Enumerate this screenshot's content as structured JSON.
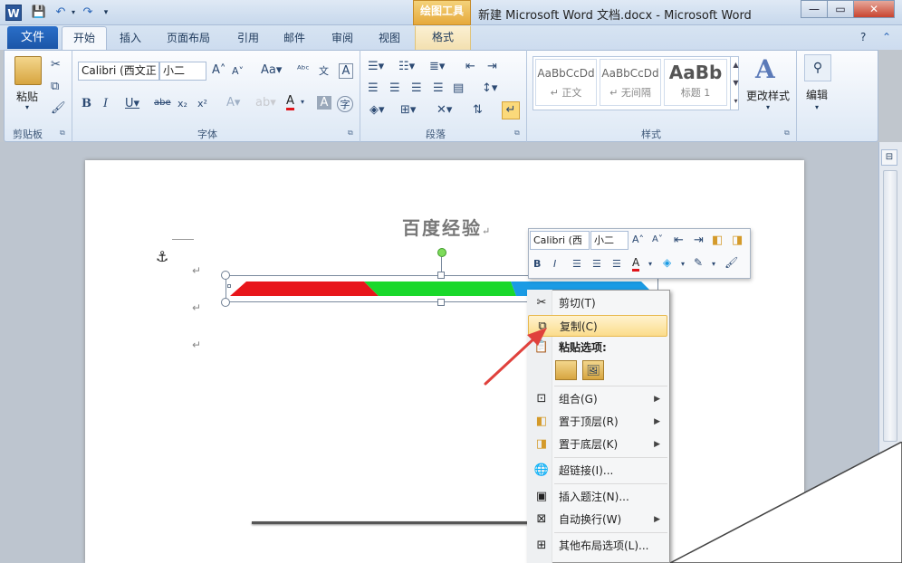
{
  "titlebar": {
    "app_icon": "W",
    "title": "新建 Microsoft Word 文档.docx - Microsoft Word",
    "context_group": "绘图工具",
    "qat_icons": [
      "save-icon",
      "undo-icon",
      "redo-icon",
      "customize-icon"
    ],
    "controls": [
      "—",
      "▭",
      "✕"
    ]
  },
  "tabs": {
    "file": "文件",
    "items": [
      "开始",
      "插入",
      "页面布局",
      "引用",
      "邮件",
      "审阅",
      "视图"
    ],
    "format": "格式"
  },
  "ribbon": {
    "clipboard": {
      "label": "剪贴板",
      "paste": "粘贴"
    },
    "font": {
      "label": "字体",
      "font_name": "Calibri (西文正",
      "font_size": "小二"
    },
    "paragraph": {
      "label": "段落"
    },
    "styles": {
      "label": "样式",
      "items": [
        {
          "sample": "AaBbCcDd",
          "name": "↵ 正文"
        },
        {
          "sample": "AaBbCcDd",
          "name": "↵ 无间隔"
        },
        {
          "sample": "AaBb",
          "name": "标题 1"
        }
      ],
      "change": "更改样式"
    },
    "editing": {
      "label": "编辑"
    }
  },
  "document": {
    "heading": "百度经验",
    "para_mark": "↵",
    "bar_colors": [
      "#e8161b",
      "#19d82b",
      "#1a9be4"
    ]
  },
  "minibar": {
    "font_name": "Calibri (西",
    "font_size": "小二"
  },
  "context_menu": {
    "cut": "剪切(T)",
    "copy": "复制(C)",
    "paste_options": "粘贴选项:",
    "group": "组合(G)",
    "bring_front": "置于顶层(R)",
    "send_back": "置于底层(K)",
    "hyperlink": "超链接(I)...",
    "caption": "插入题注(N)...",
    "wrap": "自动换行(W)",
    "layout": "其他布局选项(L)..."
  }
}
